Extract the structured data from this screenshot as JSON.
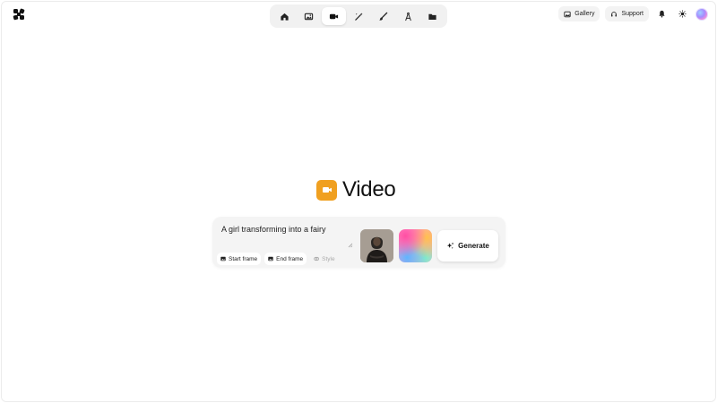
{
  "app": {
    "title": "Video"
  },
  "nav": {
    "items": [
      {
        "name": "home",
        "icon": "home-icon",
        "active": false
      },
      {
        "name": "image",
        "icon": "image-icon",
        "active": false
      },
      {
        "name": "video",
        "icon": "video-camera-icon",
        "active": true
      },
      {
        "name": "enhance",
        "icon": "magic-wand-icon",
        "active": false
      },
      {
        "name": "edit",
        "icon": "brush-icon",
        "active": false
      },
      {
        "name": "train",
        "icon": "compass-icon",
        "active": false
      },
      {
        "name": "files",
        "icon": "folder-icon",
        "active": false
      }
    ]
  },
  "header": {
    "gallery_label": "Gallery",
    "support_label": "Support"
  },
  "prompt": {
    "value": "A girl transforming into a fairy",
    "start_frame_label": "Start frame",
    "end_frame_label": "End frame",
    "style_label": "Style",
    "generate_label": "Generate"
  },
  "colors": {
    "accent": "#f0a020"
  }
}
